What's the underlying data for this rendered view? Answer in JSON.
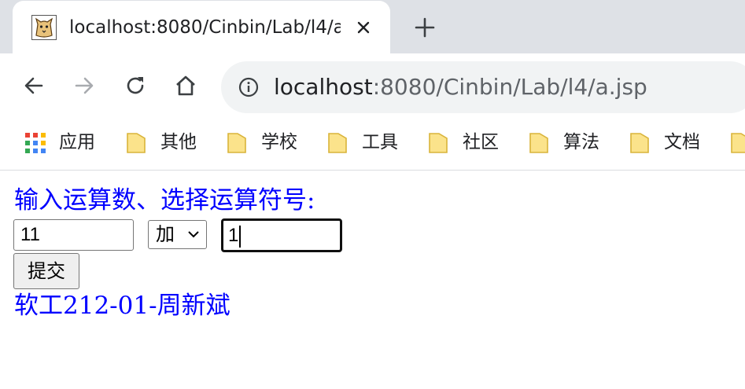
{
  "browser": {
    "tab": {
      "title": "localhost:8080/Cinbin/Lab/l4/a.jsp",
      "favicon": "tomcat-cat-icon"
    },
    "toolbar": {
      "back_icon": "back-arrow-icon",
      "forward_icon": "forward-arrow-icon",
      "reload_icon": "reload-icon",
      "home_icon": "home-icon"
    },
    "address_bar": {
      "info_icon": "info-icon",
      "host": "localhost",
      "rest": ":8080/Cinbin/Lab/l4/a.jsp"
    },
    "bookmarks": [
      {
        "label": "应用",
        "icon": "apps-grid-icon"
      },
      {
        "label": "其他",
        "icon": "folder-icon"
      },
      {
        "label": "学校",
        "icon": "folder-icon"
      },
      {
        "label": "工具",
        "icon": "folder-icon"
      },
      {
        "label": "社区",
        "icon": "folder-icon"
      },
      {
        "label": "算法",
        "icon": "folder-icon"
      },
      {
        "label": "文档",
        "icon": "folder-icon"
      }
    ]
  },
  "page": {
    "prompt": "输入运算数、选择运算符号:",
    "operand1": "11",
    "operator": "加",
    "operand2": "1",
    "submit_label": "提交",
    "footer": "软工212-01-周新斌"
  },
  "colors": {
    "page_text": "#0000ff",
    "tabstrip_bg": "#dee1e6",
    "omnibox_bg": "#f1f3f4",
    "folder_yellow": "#fbe38b"
  }
}
